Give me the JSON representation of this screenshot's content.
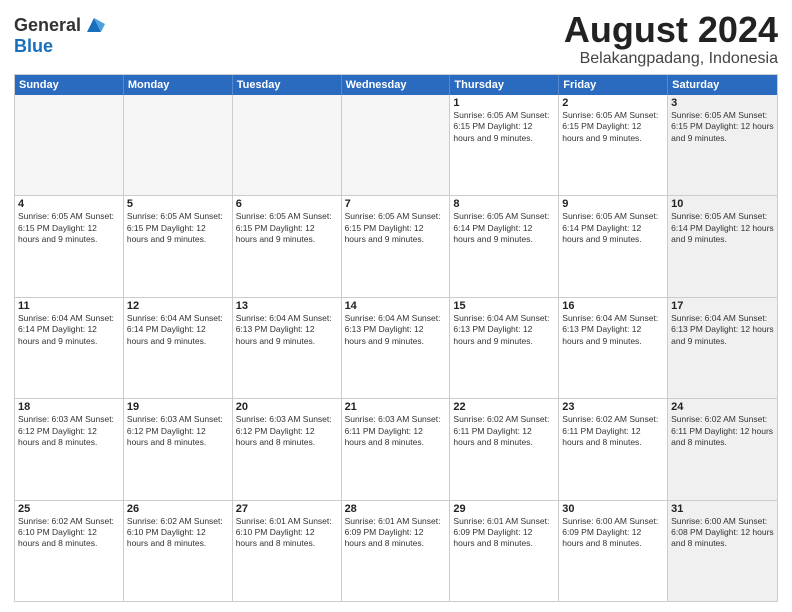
{
  "logo": {
    "general": "General",
    "blue": "Blue"
  },
  "title": {
    "month_year": "August 2024",
    "location": "Belakangpadang, Indonesia"
  },
  "weekdays": [
    "Sunday",
    "Monday",
    "Tuesday",
    "Wednesday",
    "Thursday",
    "Friday",
    "Saturday"
  ],
  "rows": [
    [
      {
        "day": "",
        "empty": true
      },
      {
        "day": "",
        "empty": true
      },
      {
        "day": "",
        "empty": true
      },
      {
        "day": "",
        "empty": true
      },
      {
        "day": "1",
        "info": "Sunrise: 6:05 AM\nSunset: 6:15 PM\nDaylight: 12 hours\nand 9 minutes."
      },
      {
        "day": "2",
        "info": "Sunrise: 6:05 AM\nSunset: 6:15 PM\nDaylight: 12 hours\nand 9 minutes."
      },
      {
        "day": "3",
        "shaded": true,
        "info": "Sunrise: 6:05 AM\nSunset: 6:15 PM\nDaylight: 12 hours\nand 9 minutes."
      }
    ],
    [
      {
        "day": "4",
        "info": "Sunrise: 6:05 AM\nSunset: 6:15 PM\nDaylight: 12 hours\nand 9 minutes."
      },
      {
        "day": "5",
        "info": "Sunrise: 6:05 AM\nSunset: 6:15 PM\nDaylight: 12 hours\nand 9 minutes."
      },
      {
        "day": "6",
        "info": "Sunrise: 6:05 AM\nSunset: 6:15 PM\nDaylight: 12 hours\nand 9 minutes."
      },
      {
        "day": "7",
        "info": "Sunrise: 6:05 AM\nSunset: 6:15 PM\nDaylight: 12 hours\nand 9 minutes."
      },
      {
        "day": "8",
        "info": "Sunrise: 6:05 AM\nSunset: 6:14 PM\nDaylight: 12 hours\nand 9 minutes."
      },
      {
        "day": "9",
        "info": "Sunrise: 6:05 AM\nSunset: 6:14 PM\nDaylight: 12 hours\nand 9 minutes."
      },
      {
        "day": "10",
        "shaded": true,
        "info": "Sunrise: 6:05 AM\nSunset: 6:14 PM\nDaylight: 12 hours\nand 9 minutes."
      }
    ],
    [
      {
        "day": "11",
        "info": "Sunrise: 6:04 AM\nSunset: 6:14 PM\nDaylight: 12 hours\nand 9 minutes."
      },
      {
        "day": "12",
        "info": "Sunrise: 6:04 AM\nSunset: 6:14 PM\nDaylight: 12 hours\nand 9 minutes."
      },
      {
        "day": "13",
        "info": "Sunrise: 6:04 AM\nSunset: 6:13 PM\nDaylight: 12 hours\nand 9 minutes."
      },
      {
        "day": "14",
        "info": "Sunrise: 6:04 AM\nSunset: 6:13 PM\nDaylight: 12 hours\nand 9 minutes."
      },
      {
        "day": "15",
        "info": "Sunrise: 6:04 AM\nSunset: 6:13 PM\nDaylight: 12 hours\nand 9 minutes."
      },
      {
        "day": "16",
        "info": "Sunrise: 6:04 AM\nSunset: 6:13 PM\nDaylight: 12 hours\nand 9 minutes."
      },
      {
        "day": "17",
        "shaded": true,
        "info": "Sunrise: 6:04 AM\nSunset: 6:13 PM\nDaylight: 12 hours\nand 9 minutes."
      }
    ],
    [
      {
        "day": "18",
        "info": "Sunrise: 6:03 AM\nSunset: 6:12 PM\nDaylight: 12 hours\nand 8 minutes."
      },
      {
        "day": "19",
        "info": "Sunrise: 6:03 AM\nSunset: 6:12 PM\nDaylight: 12 hours\nand 8 minutes."
      },
      {
        "day": "20",
        "info": "Sunrise: 6:03 AM\nSunset: 6:12 PM\nDaylight: 12 hours\nand 8 minutes."
      },
      {
        "day": "21",
        "info": "Sunrise: 6:03 AM\nSunset: 6:11 PM\nDaylight: 12 hours\nand 8 minutes."
      },
      {
        "day": "22",
        "info": "Sunrise: 6:02 AM\nSunset: 6:11 PM\nDaylight: 12 hours\nand 8 minutes."
      },
      {
        "day": "23",
        "info": "Sunrise: 6:02 AM\nSunset: 6:11 PM\nDaylight: 12 hours\nand 8 minutes."
      },
      {
        "day": "24",
        "shaded": true,
        "info": "Sunrise: 6:02 AM\nSunset: 6:11 PM\nDaylight: 12 hours\nand 8 minutes."
      }
    ],
    [
      {
        "day": "25",
        "info": "Sunrise: 6:02 AM\nSunset: 6:10 PM\nDaylight: 12 hours\nand 8 minutes."
      },
      {
        "day": "26",
        "info": "Sunrise: 6:02 AM\nSunset: 6:10 PM\nDaylight: 12 hours\nand 8 minutes."
      },
      {
        "day": "27",
        "info": "Sunrise: 6:01 AM\nSunset: 6:10 PM\nDaylight: 12 hours\nand 8 minutes."
      },
      {
        "day": "28",
        "info": "Sunrise: 6:01 AM\nSunset: 6:09 PM\nDaylight: 12 hours\nand 8 minutes."
      },
      {
        "day": "29",
        "info": "Sunrise: 6:01 AM\nSunset: 6:09 PM\nDaylight: 12 hours\nand 8 minutes."
      },
      {
        "day": "30",
        "info": "Sunrise: 6:00 AM\nSunset: 6:09 PM\nDaylight: 12 hours\nand 8 minutes."
      },
      {
        "day": "31",
        "shaded": true,
        "info": "Sunrise: 6:00 AM\nSunset: 6:08 PM\nDaylight: 12 hours\nand 8 minutes."
      }
    ]
  ]
}
